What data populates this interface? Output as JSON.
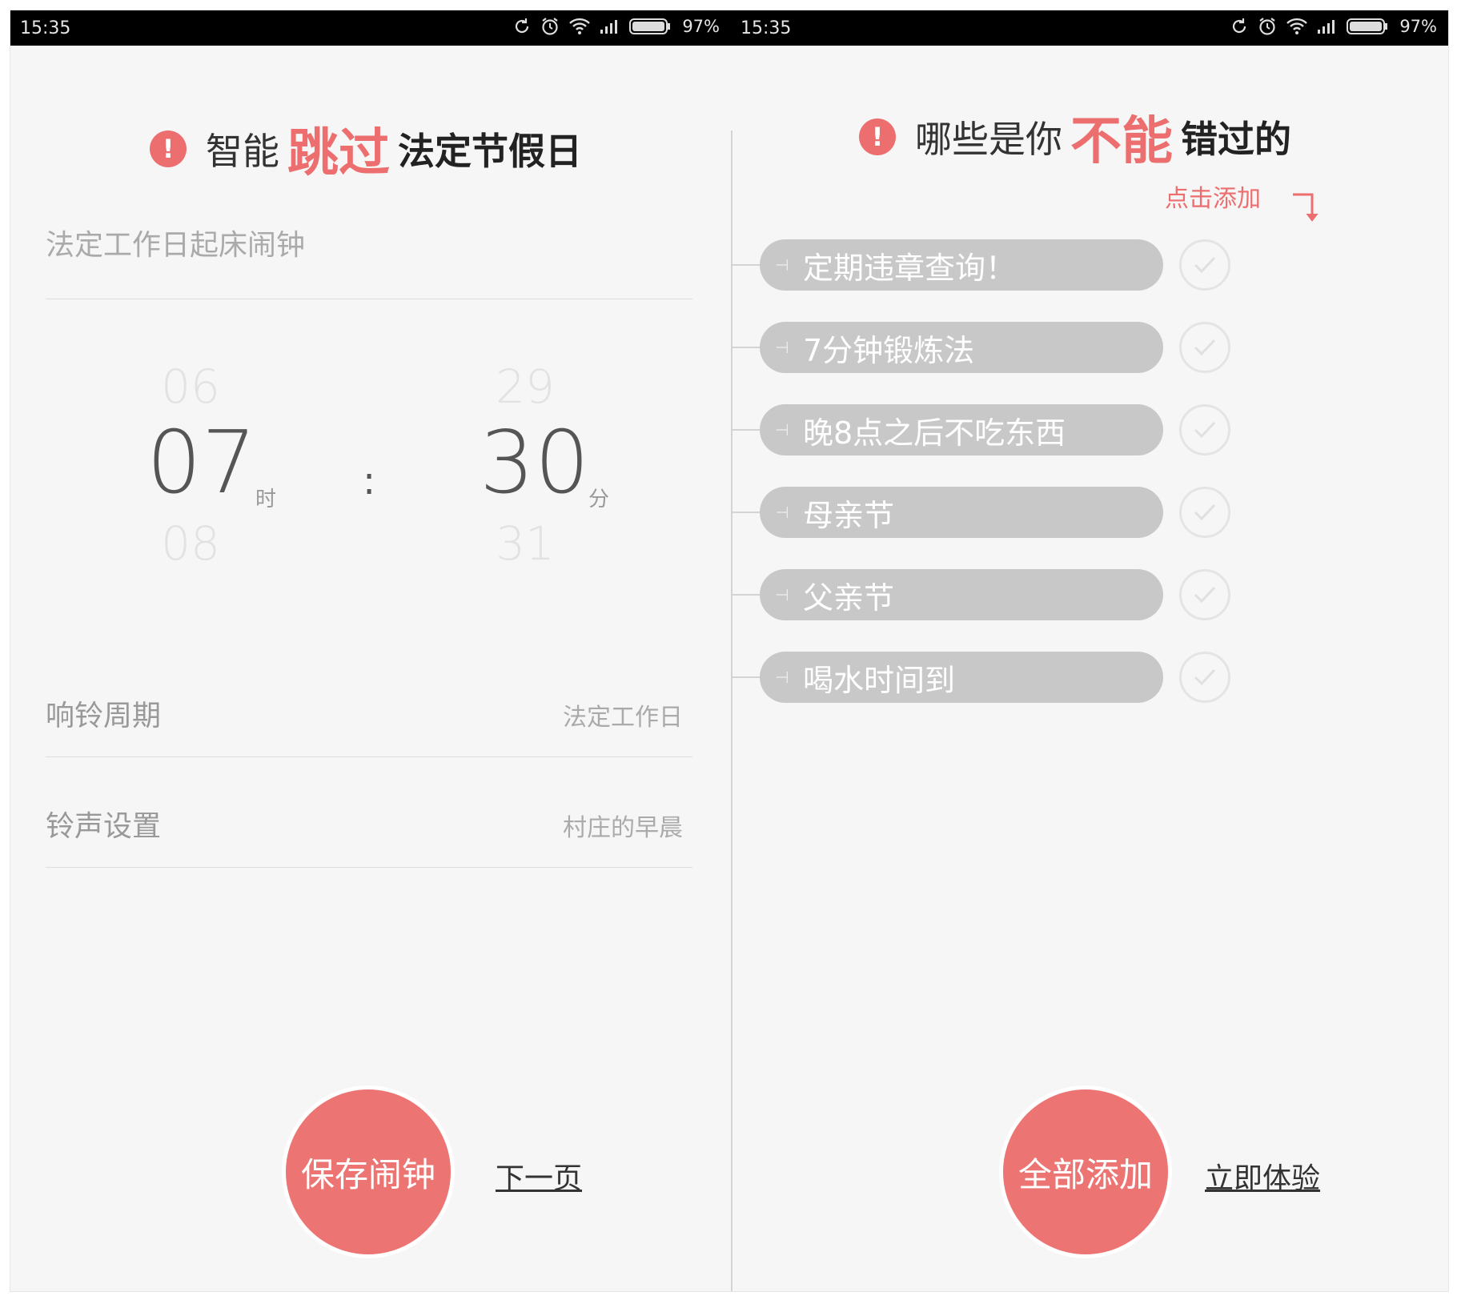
{
  "status_bar": {
    "time": "15:35",
    "battery": "97%"
  },
  "left": {
    "title": {
      "pre": "智能",
      "highlight": "跳过",
      "post": "法定节假日"
    },
    "alarm_name_label": "法定工作日起床闹钟",
    "time_picker": {
      "hour_prev": "06",
      "hour": "07",
      "hour_next": "08",
      "hour_unit": "时",
      "separator": ":",
      "minute_prev": "29",
      "minute": "30",
      "minute_next": "31",
      "minute_unit": "分"
    },
    "settings": [
      {
        "label": "响铃周期",
        "value": "法定工作日"
      },
      {
        "label": "铃声设置",
        "value": "村庄的早晨"
      }
    ],
    "save_button": "保存闹钟",
    "next_link": "下一页"
  },
  "right": {
    "title": {
      "pre": "哪些是你",
      "highlight": "不能",
      "post": "错过的"
    },
    "hint": "点击添加",
    "items": [
      {
        "label": "定期违章查询！"
      },
      {
        "label": "7分钟锻炼法"
      },
      {
        "label": "晚8点之后不吃东西"
      },
      {
        "label": "母亲节"
      },
      {
        "label": "父亲节"
      },
      {
        "label": "喝水时间到"
      }
    ],
    "add_all_button": "全部添加",
    "try_link": "立即体验"
  },
  "colors": {
    "accent": "#ec6e6e",
    "pill": "#c8c8c8",
    "status_bar": "#000000"
  },
  "icons": [
    "alert-icon",
    "sync-icon",
    "alarm-icon",
    "wifi-icon",
    "signal-icon",
    "battery-icon",
    "arrow-down-icon",
    "check-icon"
  ]
}
